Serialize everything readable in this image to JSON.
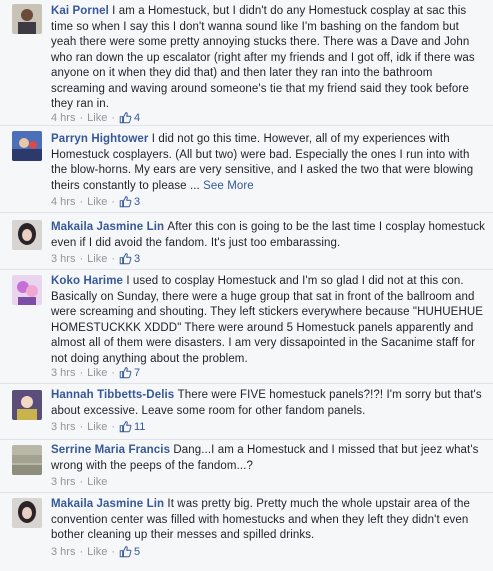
{
  "comments": [
    {
      "author": "Kai Pornel",
      "text": "I am a Homestuck, but I didn't do any Homestuck cosplay at sac this time so when I say this I don't wanna sound like I'm bashing on the fandom but yeah there were some pretty annoying stucks there. There was a Dave and John who ran down the up escalator (right after my friends and I got off, idk if there was anyone on it when they did that) and then later they ran into the bathroom screaming and waving around someone's tie that my friend said they took before they ran in.",
      "see_more": "",
      "time": "4 hrs",
      "like_label": "Like",
      "likes": "4",
      "separator": "·"
    },
    {
      "author": "Parryn Hightower",
      "text": "I did not go this time. However, all of my experiences with Homestuck cosplayers. (All but two) were bad. Especially the ones I run into with the blow-horns. My ears are very sensitive, and I asked the two that were blowing theirs constantly to please ...",
      "see_more": "See More",
      "time": "4 hrs",
      "like_label": "Like",
      "likes": "3",
      "separator": "·"
    },
    {
      "author": "Makaila Jasmine Lin",
      "text": "After this con is going to be the last time I cosplay homestuck even if I did avoid the fandom. It's just too embarassing.",
      "see_more": "",
      "time": "3 hrs",
      "like_label": "Like",
      "likes": "3",
      "separator": "·"
    },
    {
      "author": "Koko Harime",
      "text": "I used to cosplay Homestuck and I'm so glad I did not at this con. Basically on Sunday, there were a huge group that sat in front of the ballroom and were screaming and shouting. They left stickers everywhere because \"HUHUEHUE HOMESTUCKKK XDDD\" There were around 5 Homestuck panels apparently and almost all of them were disasters. I am very dissapointed in the Sacanime staff for not doing anything about the problem.",
      "see_more": "",
      "time": "3 hrs",
      "like_label": "Like",
      "likes": "7",
      "separator": "·"
    },
    {
      "author": "Hannah Tibbetts-Delis",
      "text": "There were FIVE homestuck panels?!?! I'm sorry but that's about excessive. Leave some room for other fandom panels.",
      "see_more": "",
      "time": "3 hrs",
      "like_label": "Like",
      "likes": "11",
      "separator": "·"
    },
    {
      "author": "Serrine Maria Francis",
      "text": "Dang...I am a Homestuck and I missed that but jeez what's wrong with the peeps of the fandom...?",
      "see_more": "",
      "time": "3 hrs",
      "like_label": "Like",
      "likes": "",
      "separator": "·"
    },
    {
      "author": "Makaila Jasmine Lin",
      "text": "It was pretty big. Pretty much the whole upstair area of the convention center was filled with homestucks and when they left they didn't even bother cleaning up their messes and spilled drinks.",
      "see_more": "",
      "time": "3 hrs",
      "like_label": "Like",
      "likes": "5",
      "separator": "·"
    }
  ],
  "colors": {
    "author": "#365899",
    "meta": "#90949c",
    "background": "#f6f7f9",
    "text": "#1d2129"
  },
  "icons": {
    "like_count": "thumbs-up-icon"
  }
}
